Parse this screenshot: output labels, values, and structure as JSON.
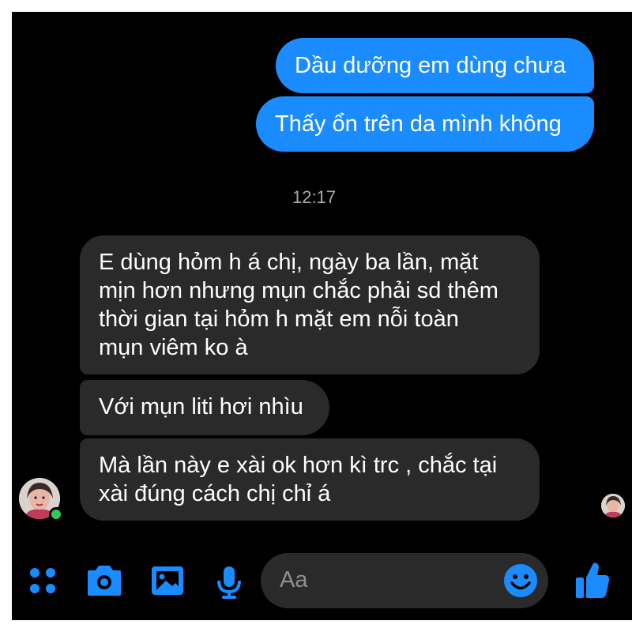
{
  "outgoing_messages": [
    {
      "text": "Dầu dưỡng em dùng chưa"
    },
    {
      "text": "Thấy ổn trên da mình không"
    }
  ],
  "timestamp": "12:17",
  "incoming_messages": [
    {
      "text": "E dùng hỏm h á chị, ngày ba lần, mặt\nmịn hơn nhưng mụn  chắc phải sd thêm\nthời gian tại hỏm h mặt em nỗi toàn\nmụn viêm ko à"
    },
    {
      "text": "Với mụn liti hơi nhìu"
    },
    {
      "text": "Mà  lần này e xài ok hơn kì trc , chắc tại\nxài đúng cách chị chỉ á"
    }
  ],
  "contact": {
    "online": true
  },
  "composer": {
    "placeholder": "Aa",
    "icons": [
      "menu-dots-icon",
      "camera-icon",
      "photo-icon",
      "microphone-icon",
      "emoji-icon",
      "thumbs-up-icon"
    ]
  },
  "colors": {
    "accent": "#1a8cff",
    "incoming_bubble": "#2a2a2b",
    "background": "#000000",
    "online": "#31c95b"
  }
}
